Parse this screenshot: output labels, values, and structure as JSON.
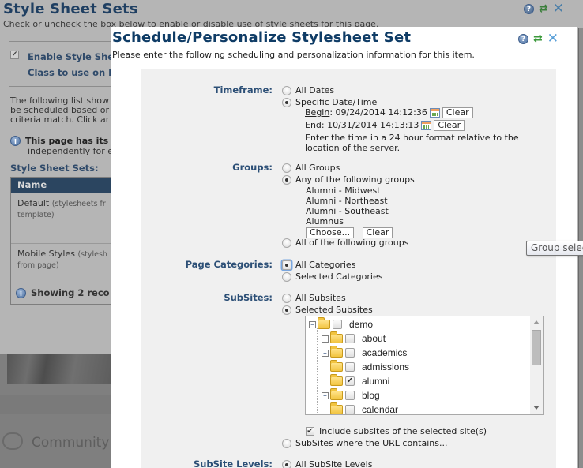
{
  "background": {
    "title": "Style Sheet Sets",
    "subtitle": "Check or uncheck the box below to enable or disable use of style sheets for this page.",
    "enable_label": "Enable Style She",
    "enable_checked": true,
    "class_label": "Class to use on B",
    "paragraph_lines": [
      "The following list show",
      "be scheduled based or",
      "criteria match. Click ar"
    ],
    "info_bold": "This page has its",
    "info_line2": "independently for e",
    "sets_heading": "Style Sheet Sets:",
    "table": {
      "header": "Name",
      "rows": [
        {
          "name": "Default",
          "note": "(stylesheets fr",
          "note2": "template)"
        },
        {
          "name": "Mobile Styles",
          "note": "(stylesh",
          "note2": "from page)"
        }
      ],
      "footer": "Showing 2 reco"
    },
    "community_label": "Community T"
  },
  "dialog": {
    "title": "Schedule/Personalize Stylesheet Set",
    "subtitle": "Please enter the following scheduling and personalization information for this item.",
    "icons": [
      "help-icon",
      "refresh-icon",
      "close-icon"
    ],
    "timeframe": {
      "label": "Timeframe:",
      "options": [
        {
          "label": "All Dates",
          "selected": false
        },
        {
          "label": "Specific Date/Time",
          "selected": true
        }
      ],
      "begin_label": "Begin",
      "begin_value": ": 09/24/2014 14:12:36",
      "end_label": "End",
      "end_value": ": 10/31/2014 14:13:13",
      "clear_label": "Clear",
      "hint_line1": "Enter the time in a 24 hour format relative to the",
      "hint_line2": "location of the server."
    },
    "groups": {
      "label": "Groups:",
      "options": [
        {
          "label": "All Groups",
          "selected": false
        },
        {
          "label": "Any of the following groups",
          "selected": true
        },
        {
          "label": "All of the following groups",
          "selected": false
        }
      ],
      "selected_groups": [
        "Alumni - Midwest",
        "Alumni - Northeast",
        "Alumni - Southeast",
        "Alumnus"
      ],
      "choose_label": "Choose...",
      "clear_label": "Clear"
    },
    "page_categories": {
      "label": "Page Categories:",
      "options": [
        {
          "label": "All Categories",
          "selected": true
        },
        {
          "label": "Selected Categories",
          "selected": false
        }
      ]
    },
    "subsites": {
      "label": "SubSites:",
      "options": [
        {
          "label": "All Subsites",
          "selected": false
        },
        {
          "label": "Selected Subsites",
          "selected": true
        },
        {
          "label": "SubSites where the URL contains...",
          "selected": false
        }
      ],
      "tree": [
        {
          "name": "demo",
          "expandable": true,
          "expanded": true,
          "checked": false,
          "level": 0
        },
        {
          "name": "about",
          "expandable": true,
          "checked": false,
          "level": 1
        },
        {
          "name": "academics",
          "expandable": true,
          "checked": false,
          "level": 1
        },
        {
          "name": "admissions",
          "expandable": false,
          "checked": false,
          "level": 1
        },
        {
          "name": "alumni",
          "expandable": false,
          "checked": true,
          "level": 1
        },
        {
          "name": "blog",
          "expandable": true,
          "checked": false,
          "level": 1
        },
        {
          "name": "calendar",
          "expandable": false,
          "checked": false,
          "level": 1
        }
      ],
      "include_label": "Include subsites of the selected site(s)",
      "include_checked": true
    },
    "subsite_levels": {
      "label": "SubSite Levels:",
      "options": [
        {
          "label": "All SubSite Levels",
          "selected": true
        }
      ]
    }
  },
  "tooltip": "Group select"
}
